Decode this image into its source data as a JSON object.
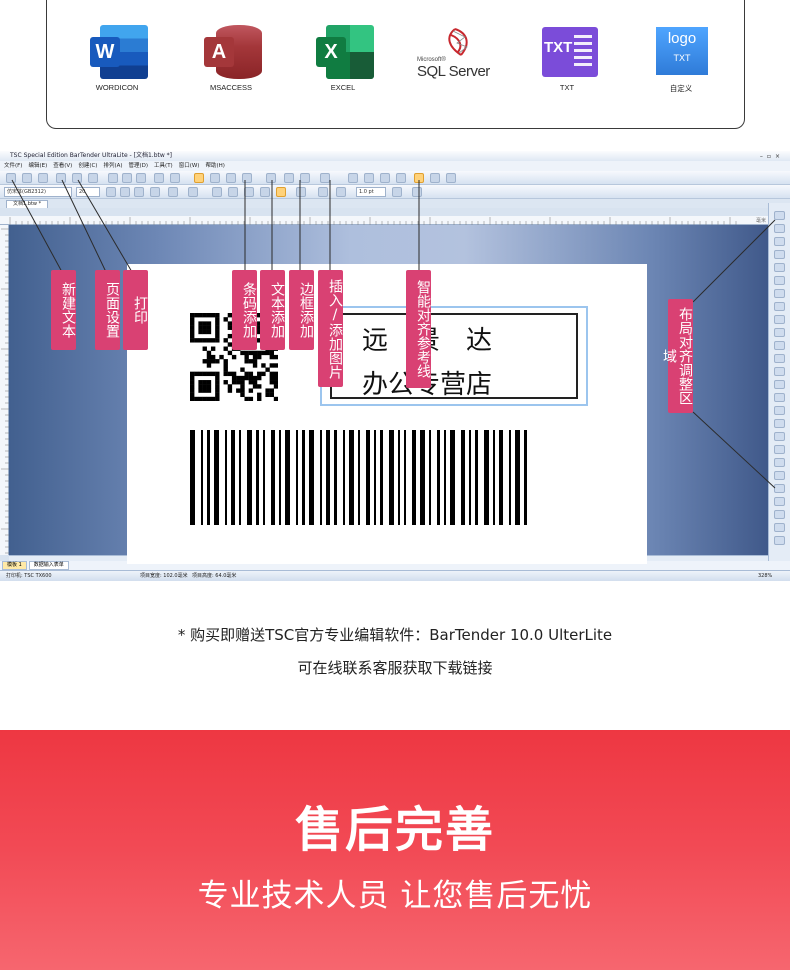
{
  "sources": [
    {
      "label": "WORDICON",
      "glyph": "W",
      "icon": "word-icon"
    },
    {
      "label": "MSACCESS",
      "glyph": "A",
      "icon": "access-icon"
    },
    {
      "label": "EXCEL",
      "glyph": "X",
      "icon": "excel-icon"
    },
    {
      "label": "",
      "icon": "sql-server-icon",
      "ms": "Microsoft®",
      "name": "SQL Server"
    },
    {
      "label": "TXT",
      "glyph": "TXT",
      "icon": "txt-icon"
    },
    {
      "label": "自定义",
      "logo_text": "logo",
      "logo_sub": "TXT",
      "icon": "custom-logo-icon"
    }
  ],
  "app": {
    "title": "TSC Special Edition BarTender UltraLite - [文档1.btw *]",
    "menu": [
      "文件(F)",
      "编辑(E)",
      "查看(V)",
      "创建(C)",
      "排列(A)",
      "管理(D)",
      "工具(T)",
      "窗口(W)",
      "帮助(H)"
    ],
    "font_name": "仿宋体(GB2312)",
    "font_size": "20",
    "line_width": "1.0 pt",
    "doc_tab": "文档1.btw *",
    "unit": "毫米",
    "sheet_tabs": [
      "模板 1",
      "数据输入表单"
    ],
    "status": {
      "printer": "打印机: TSC TX600",
      "width": "项目宽度: 102.0毫米",
      "height": "项目高度: 64.0毫米",
      "zoom": "328%"
    }
  },
  "label": {
    "line1": "远　景　达",
    "line2": "办公专营店"
  },
  "annotations": {
    "new_doc": "新建文本",
    "page_setup": "页面设置",
    "print": "打印",
    "barcode": "条码添加",
    "text": "文本添加",
    "border": "边框添加",
    "image": "插入/添加图片",
    "align": "智能对齐参考线",
    "layout": "布局对齐调整区域"
  },
  "notes": {
    "line1": "* 购买即赠送TSC官方专业编辑软件：BarTender 10.0 UlterLite",
    "line2": "可在线联系客服获取下载链接"
  },
  "banner": {
    "title": "售后完善",
    "subtitle": "专业技术人员 让您售后无忧"
  },
  "colors": {
    "tag": "#d94173",
    "banner": "#ee3742"
  }
}
